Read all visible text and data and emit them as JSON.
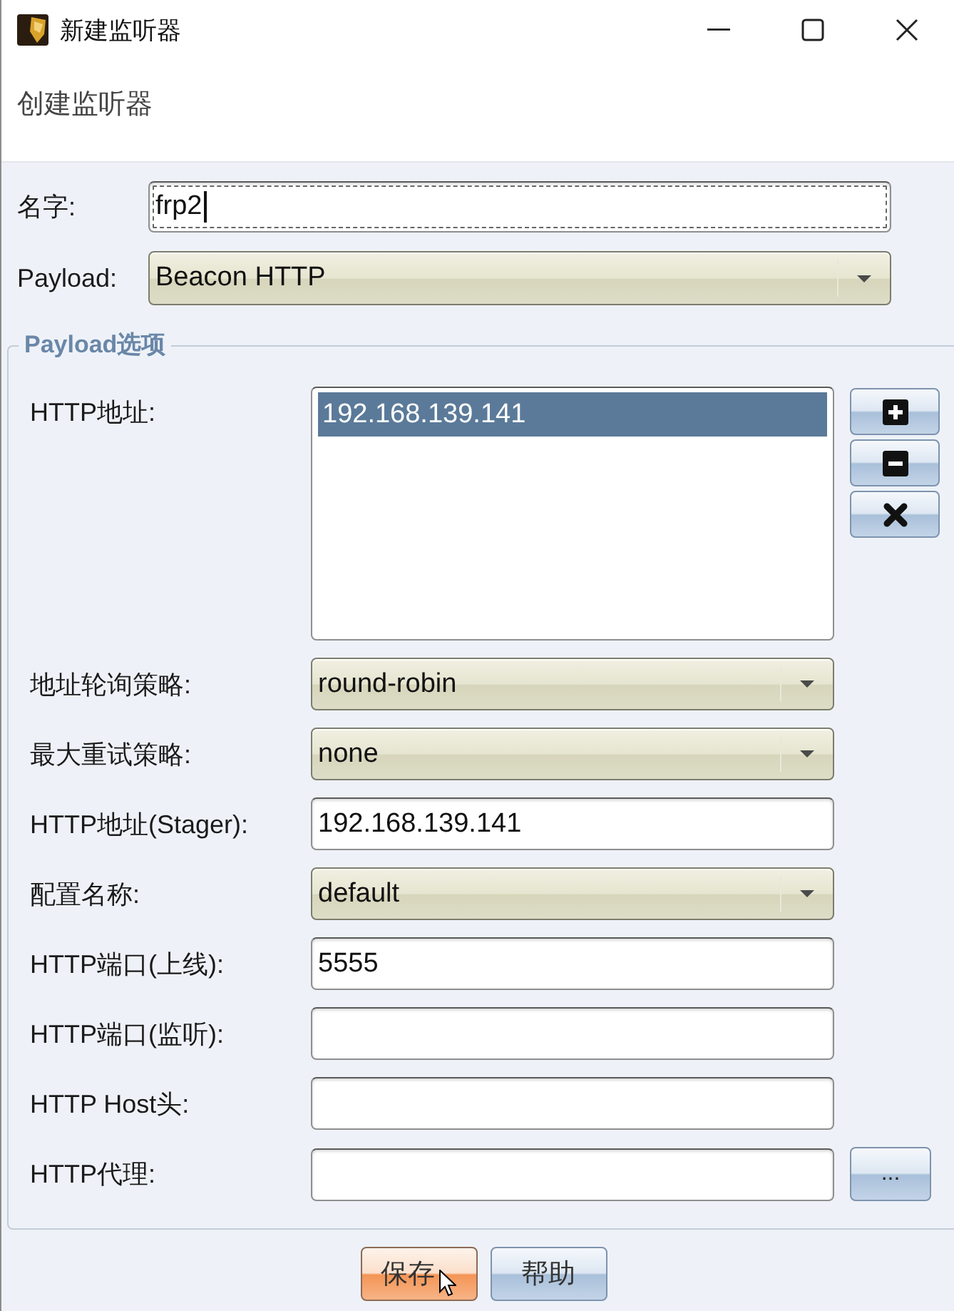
{
  "window": {
    "title": "新建监听器"
  },
  "header": {
    "title": "创建监听器"
  },
  "fields": [
    {
      "kind": "text",
      "label": "名字:",
      "value": "frp2",
      "focused": true
    },
    {
      "kind": "select",
      "label": "Payload:",
      "value": "Beacon HTTP",
      "focused": false
    }
  ],
  "payload_options": {
    "title": "Payload选项",
    "fields": [
      {
        "kind": "list",
        "label": "HTTP地址:",
        "items": [
          {
            "text": "192.168.139.141",
            "selected": true
          }
        ],
        "actions": [
          {
            "kind": "add"
          },
          {
            "kind": "remove"
          },
          {
            "kind": "clear"
          }
        ]
      },
      {
        "kind": "select",
        "label": "地址轮询策略:",
        "value": "round-robin"
      },
      {
        "kind": "select",
        "label": "最大重试策略:",
        "value": "none"
      },
      {
        "kind": "text",
        "label": "HTTP地址(Stager):",
        "value": "192.168.139.141"
      },
      {
        "kind": "select",
        "label": "配置名称:",
        "value": "default"
      },
      {
        "kind": "text",
        "label": "HTTP端口(上线):",
        "value": "5555"
      },
      {
        "kind": "text",
        "label": "HTTP端口(监听):"
      },
      {
        "kind": "text",
        "label": "HTTP Host头:"
      },
      {
        "kind": "text",
        "label": "HTTP代理:",
        "button": "..."
      }
    ]
  },
  "buttons": [
    {
      "label": "保存",
      "hovered": true
    },
    {
      "label": "帮助",
      "hovered": false
    }
  ]
}
